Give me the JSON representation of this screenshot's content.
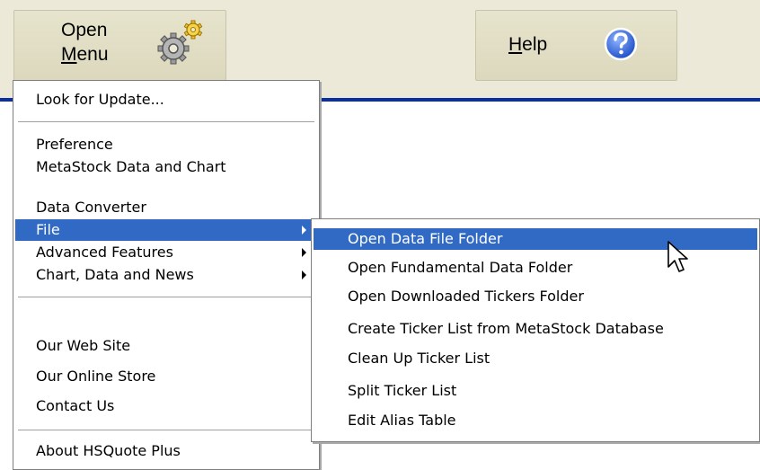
{
  "toolbar": {
    "open_menu": {
      "line1": "Open",
      "line2_underlined": "M",
      "line2_rest": "enu",
      "icon": "gear-icon"
    },
    "help": {
      "underlined": "H",
      "rest": "elp",
      "icon": "help-question-icon"
    },
    "accent_color": "#0a2fa0"
  },
  "main_menu": {
    "items": [
      {
        "label": "Look for Update..."
      },
      {
        "label": "Preference"
      },
      {
        "label": "MetaStock Data and Chart"
      },
      {
        "label": "Data Converter"
      },
      {
        "label": "File",
        "highlighted": true,
        "submenu": true
      },
      {
        "label": "Advanced Features",
        "submenu": true
      },
      {
        "label": "Chart, Data and News",
        "submenu": true
      },
      {
        "label": "Our Web Site"
      },
      {
        "label": "Our Online Store"
      },
      {
        "label": "Contact Us"
      },
      {
        "label": "About HSQuote Plus"
      }
    ]
  },
  "file_submenu": {
    "items": [
      {
        "label": "Open Data File Folder",
        "highlighted": true
      },
      {
        "label": "Open Fundamental Data Folder"
      },
      {
        "label": "Open Downloaded Tickers Folder"
      },
      {
        "label": "Create Ticker List from MetaStock Database"
      },
      {
        "label": "Clean Up Ticker List"
      },
      {
        "label": "Split Ticker List"
      },
      {
        "label": "Edit Alias Table"
      }
    ]
  },
  "colors": {
    "highlight": "#316ac5",
    "highlight_text": "#ffffff",
    "background": "#ece9d8"
  }
}
